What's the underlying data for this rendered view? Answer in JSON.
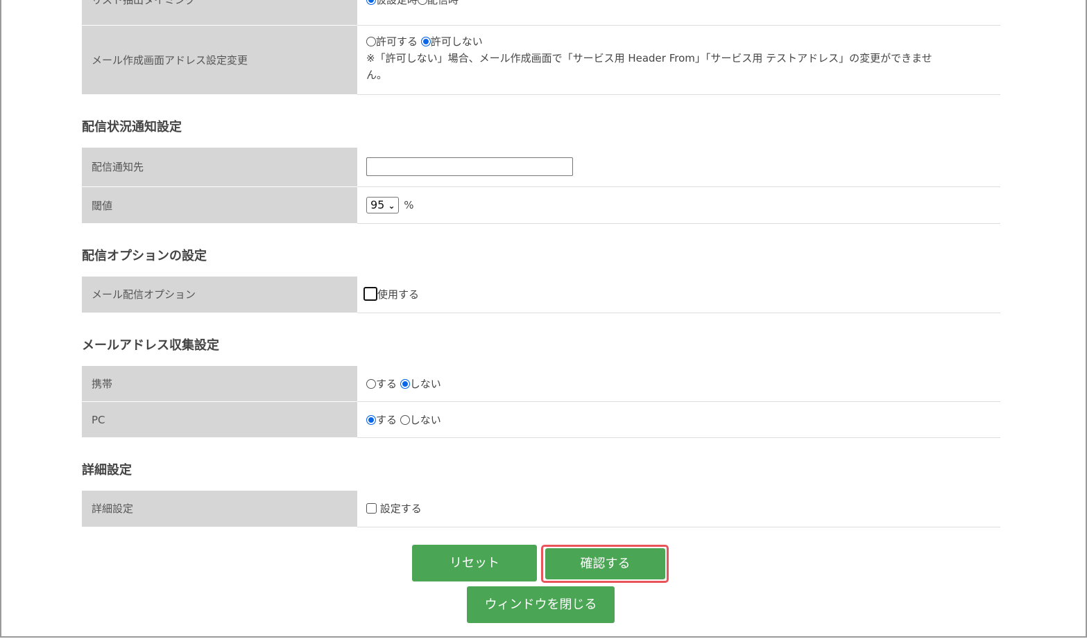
{
  "rows_top": [
    {
      "label": "リスト抽出タイミング",
      "options": [
        {
          "text": "仮設定時",
          "checked": true
        },
        {
          "text": "配信時",
          "checked": false
        }
      ]
    },
    {
      "label": "メール作成画面アドレス設定変更",
      "options": [
        {
          "text": "許可する",
          "checked": false
        },
        {
          "text": "許可しない",
          "checked": true
        }
      ],
      "note_line1": "※「許可しない」場合、メール作成画面で「サービス用 Header From」「サービス用 テストアドレス」の変更ができませ",
      "note_line2": "ん。"
    }
  ],
  "sections": {
    "delivery_notice": {
      "title": "配信状況通知設定",
      "notify_label": "配信通知先",
      "notify_value": "",
      "threshold_label": "閾値",
      "threshold_value": "95",
      "threshold_unit": "%"
    },
    "delivery_option": {
      "title": "配信オプションの設定",
      "label": "メール配信オプション",
      "checkbox_text": "使用する",
      "checked": false
    },
    "address_collect": {
      "title": "メールアドレス収集設定",
      "mobile_label": "携帯",
      "mobile_yes": "する",
      "mobile_no": "しない",
      "mobile_value": "no",
      "pc_label": "PC",
      "pc_yes": "する",
      "pc_no": "しない",
      "pc_value": "yes"
    },
    "detail": {
      "title": "詳細設定",
      "label": "詳細設定",
      "checkbox_text": "設定する",
      "checked": false
    }
  },
  "buttons": {
    "reset": "リセット",
    "confirm": "確認する",
    "close": "ウィンドウを閉じる"
  },
  "colors": {
    "button": "#4aa654",
    "highlight": "#e8545a",
    "label_bg": "#d6d6d6",
    "radio_on": "#0a66e8"
  }
}
